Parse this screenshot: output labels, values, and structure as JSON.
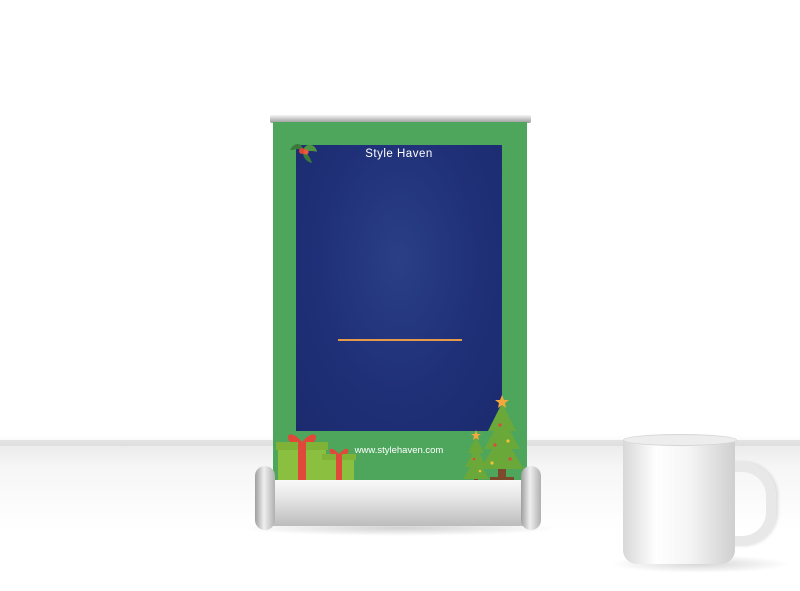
{
  "banner": {
    "brand": "Style Haven",
    "website": "www.stylehaven.com"
  },
  "colors": {
    "banner_green": "#4da65c",
    "panel_navy": "#1f3078",
    "accent_orange": "#e59a4a",
    "gift_red": "#e0483a",
    "gift_green": "#8bbf3f",
    "tree_green": "#6aa83a"
  },
  "icons": [
    "holly-icon",
    "gift-boxes-icon",
    "christmas-trees-icon",
    "coffee-mug-icon"
  ]
}
